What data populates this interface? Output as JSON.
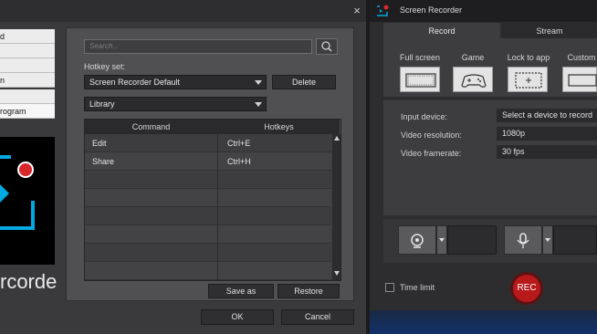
{
  "dialog": {
    "close_glyph": "×",
    "sidebar_items": [
      "d",
      "",
      "",
      "n",
      "",
      "rogram"
    ],
    "logo_text": "rcorder",
    "search": {
      "placeholder": "Search..."
    },
    "hotkey_set_label": "Hotkey set:",
    "hotkey_set_value": "Screen Recorder Default",
    "delete_label": "Delete",
    "category_value": "Library",
    "table": {
      "headers": [
        "Command",
        "Hotkeys"
      ],
      "rows": [
        {
          "command": "Edit",
          "hotkey": "Ctrl+E"
        },
        {
          "command": "Share",
          "hotkey": "Ctrl+H"
        }
      ]
    },
    "save_as_label": "Save as",
    "restore_label": "Restore",
    "ok_label": "OK",
    "cancel_label": "Cancel"
  },
  "recorder": {
    "title": "Screen Recorder",
    "tabs": [
      "Record",
      "Stream"
    ],
    "modes": [
      "Full screen",
      "Game",
      "Lock to app",
      "Custom"
    ],
    "settings": [
      {
        "label": "Input device:",
        "value": "Select a device to record"
      },
      {
        "label": "Video resolution:",
        "value": "1080p"
      },
      {
        "label": "Video framerate:",
        "value": "30 fps"
      }
    ],
    "time_limit_label": "Time limit",
    "rec_label": "REC"
  },
  "colors": {
    "accent": "#00a9e0",
    "rec": "#b8191a"
  }
}
